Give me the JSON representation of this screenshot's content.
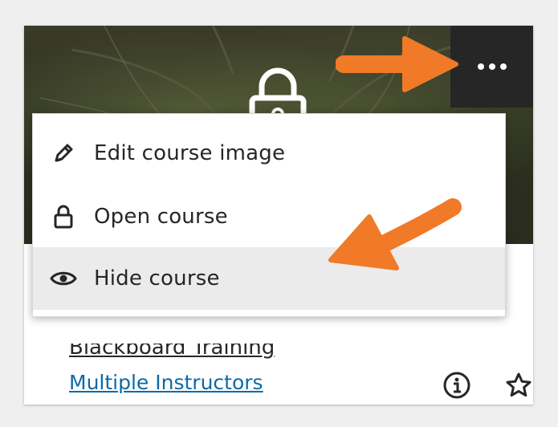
{
  "menu": {
    "items": [
      {
        "label": "Edit course image",
        "icon": "pencil-icon"
      },
      {
        "label": "Open course",
        "icon": "lock-icon"
      },
      {
        "label": "Hide course",
        "icon": "eye-icon"
      }
    ],
    "highlighted_item": "Hide course"
  },
  "card": {
    "title": "Blackboard Training",
    "instructor_link": "Multiple Instructors",
    "badge_icon": "lock-icon",
    "more_button_icon": "more-options-icon",
    "info_icon": "info-icon",
    "favorite_icon": "star-icon"
  },
  "annotations": {
    "arrow_color": "#f07a28",
    "arrows": [
      "arrow-to-more-button",
      "arrow-to-hide-course"
    ]
  },
  "colors": {
    "link": "#0c6aa6",
    "menu_highlight": "#ebebeb",
    "more_button_bg": "#262626"
  }
}
